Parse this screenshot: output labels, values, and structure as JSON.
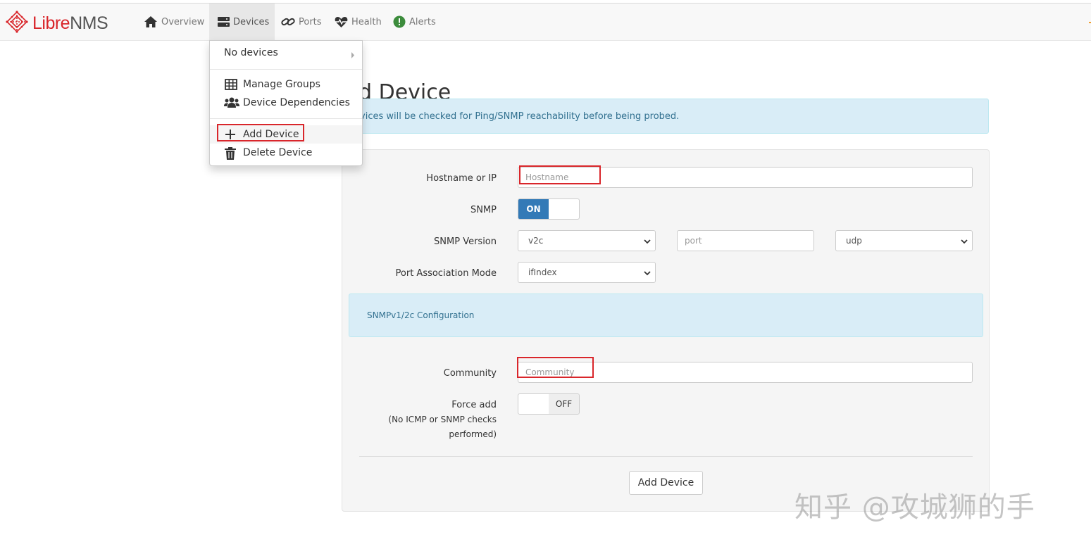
{
  "brand": {
    "prefix": "Libre",
    "suffix": "NMS",
    "accent": "#d9262b"
  },
  "nav": {
    "items": [
      {
        "label": "Overview",
        "icon": "home-icon"
      },
      {
        "label": "Devices",
        "icon": "server-icon"
      },
      {
        "label": "Ports",
        "icon": "link-icon"
      },
      {
        "label": "Health",
        "icon": "heartbeat-icon"
      },
      {
        "label": "Alerts",
        "icon": "alert-circle-icon"
      }
    ]
  },
  "devices_menu": {
    "no_devices": "No devices",
    "manage_groups": "Manage Groups",
    "device_dependencies": "Device Dependencies",
    "add_device": "Add Device",
    "delete_device": "Delete Device"
  },
  "page": {
    "title": "Add Device",
    "info": "Devices will be checked for Ping/SNMP reachability before being probed."
  },
  "form": {
    "hostname_label": "Hostname or IP",
    "hostname_placeholder": "Hostname",
    "snmp_label": "SNMP",
    "snmp_toggle": "ON",
    "snmp_version_label": "SNMP Version",
    "snmp_version_value": "v2c",
    "port_placeholder": "port",
    "transport_value": "udp",
    "port_assoc_label": "Port Association Mode",
    "port_assoc_value": "ifIndex",
    "snmp_config_heading": "SNMPv1/2c Configuration",
    "community_label": "Community",
    "community_placeholder": "Community",
    "force_add_label": "Force add",
    "force_add_note_1": "(No ICMP or SNMP checks",
    "force_add_note_2": "performed)",
    "force_add_toggle": "OFF",
    "submit_label": "Add Device"
  },
  "watermark": "知乎 @攻城狮的手"
}
